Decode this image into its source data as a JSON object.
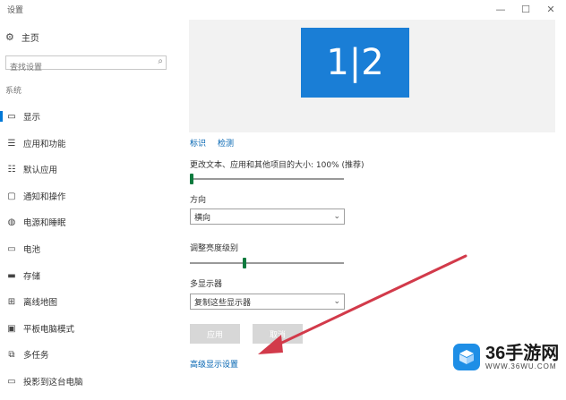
{
  "window": {
    "title": "设置",
    "minimize_glyph": "—",
    "maximize_glyph": "☐",
    "close_glyph": "✕"
  },
  "sidebar": {
    "home_label": "主页",
    "search_placeholder": "查找设置",
    "section_label": "系统",
    "items": [
      {
        "label": "显示",
        "icon": "display-icon",
        "glyph": "▭"
      },
      {
        "label": "应用和功能",
        "icon": "apps-icon",
        "glyph": "☰"
      },
      {
        "label": "默认应用",
        "icon": "default-apps-icon",
        "glyph": "☷"
      },
      {
        "label": "通知和操作",
        "icon": "notifications-icon",
        "glyph": "▢"
      },
      {
        "label": "电源和睡眠",
        "icon": "power-icon",
        "glyph": "◍"
      },
      {
        "label": "电池",
        "icon": "battery-icon",
        "glyph": "▭"
      },
      {
        "label": "存储",
        "icon": "storage-icon",
        "glyph": "▬"
      },
      {
        "label": "离线地图",
        "icon": "offline-maps-icon",
        "glyph": "⊞"
      },
      {
        "label": "平板电脑模式",
        "icon": "tablet-mode-icon",
        "glyph": "▣"
      },
      {
        "label": "多任务",
        "icon": "multitasking-icon",
        "glyph": "⧉"
      },
      {
        "label": "投影到这台电脑",
        "icon": "projecting-icon",
        "glyph": "▭"
      }
    ]
  },
  "main": {
    "monitor_label": "1|2",
    "identify_link": "标识",
    "detect_link": "检测",
    "scale_label": "更改文本、应用和其他项目的大小: 100% (推荐)",
    "scale_value": 0.0,
    "orientation_label": "方向",
    "orientation_value": "横向",
    "brightness_label": "调整亮度级别",
    "brightness_value": 0.35,
    "multi_display_label": "多显示器",
    "multi_display_value": "复制这些显示器",
    "apply_button": "应用",
    "cancel_button": "取消",
    "advanced_link": "高级显示设置"
  },
  "watermark": {
    "brand": "36手游网",
    "url": "WWW.36WU.COM"
  },
  "colors": {
    "accent": "#0078d7",
    "monitor": "#1a7ed6",
    "link": "#0063b1",
    "arrow": "#d23a4a"
  }
}
